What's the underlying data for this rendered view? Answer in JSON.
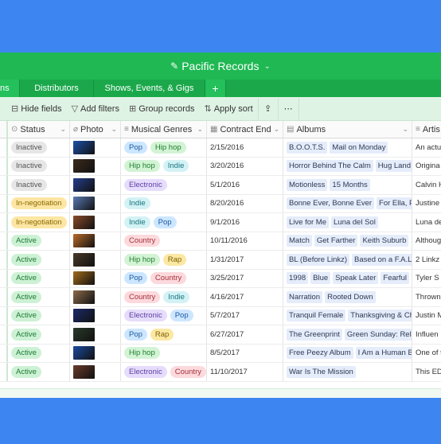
{
  "app": {
    "title": "Pacific Records"
  },
  "tabs": [
    {
      "label": "ns"
    },
    {
      "label": "Distributors"
    },
    {
      "label": "Shows, Events, & Gigs"
    },
    {
      "label": "+"
    }
  ],
  "toolbar": {
    "hide_fields": "Hide fields",
    "add_filters": "Add filters",
    "group_records": "Group records",
    "apply_sort": "Apply sort"
  },
  "columns": [
    "Status",
    "Photo",
    "Musical Genres",
    "Contract End",
    "Albums",
    "Artis"
  ],
  "rows": [
    {
      "status": "Inactive",
      "status_kind": "inactive",
      "photo_color": "#1c4fa8",
      "genres": [
        [
          "Pop",
          "pop"
        ],
        [
          "Hip hop",
          "hiphop"
        ]
      ],
      "date": "2/15/2016",
      "albums": [
        "B.O.O.T.S.",
        "Mail on Monday"
      ],
      "artist": "An actu"
    },
    {
      "status": "Inactive",
      "status_kind": "inactive",
      "photo_color": "#3b2a1c",
      "genres": [
        [
          "Hip hop",
          "hiphop"
        ],
        [
          "Indie",
          "indie"
        ]
      ],
      "date": "3/20/2016",
      "albums": [
        "Horror Behind The Calm",
        "Hug Land"
      ],
      "artist": "Origina"
    },
    {
      "status": "Inactive",
      "status_kind": "inactive",
      "photo_color": "#243e8c",
      "genres": [
        [
          "Electronic",
          "electronic"
        ]
      ],
      "date": "5/1/2016",
      "albums": [
        "Motionless",
        "15 Months"
      ],
      "artist": "Calvin H"
    },
    {
      "status": "In-negotiation",
      "status_kind": "neg",
      "photo_color": "#5a7ab4",
      "genres": [
        [
          "Indie",
          "indie"
        ]
      ],
      "date": "8/20/2016",
      "albums": [
        "Bonne Ever, Bonne Ever",
        "For Ella, P"
      ],
      "artist": "Justine"
    },
    {
      "status": "In-negotiation",
      "status_kind": "neg",
      "photo_color": "#8a4a2a",
      "genres": [
        [
          "Indie",
          "indie"
        ],
        [
          "Pop",
          "pop"
        ]
      ],
      "date": "9/1/2016",
      "albums": [
        "Live for Me",
        "Luna del Sol"
      ],
      "artist": "Luna de"
    },
    {
      "status": "Active",
      "status_kind": "active",
      "photo_color": "#b96a2a",
      "genres": [
        [
          "Country",
          "country"
        ]
      ],
      "date": "10/11/2016",
      "albums": [
        "Match",
        "Get Farther",
        "Keith Suburb"
      ],
      "artist": "Althoug"
    },
    {
      "status": "Active",
      "status_kind": "active",
      "photo_color": "#4a3a2a",
      "genres": [
        [
          "Hip hop",
          "hiphop"
        ],
        [
          "Rap",
          "rap"
        ]
      ],
      "date": "1/31/2017",
      "albums": [
        "BL (Before Linkz)",
        "Based on a F.A.L"
      ],
      "artist": "2 Linkz"
    },
    {
      "status": "Active",
      "status_kind": "active",
      "photo_color": "#a26a1c",
      "genres": [
        [
          "Pop",
          "pop"
        ],
        [
          "Country",
          "country"
        ]
      ],
      "date": "3/25/2017",
      "albums": [
        "1998",
        "Blue",
        "Speak Later",
        "Fearful"
      ],
      "artist": "Tyler S"
    },
    {
      "status": "Active",
      "status_kind": "active",
      "photo_color": "#8c6a4a",
      "genres": [
        [
          "Country",
          "country"
        ],
        [
          "Indie",
          "indie"
        ]
      ],
      "date": "4/16/2017",
      "albums": [
        "Narration",
        "Rooted Down"
      ],
      "artist": "Thrown"
    },
    {
      "status": "Active",
      "status_kind": "active",
      "photo_color": "#1a2a6a",
      "genres": [
        [
          "Electronic",
          "electronic"
        ],
        [
          "Pop",
          "pop"
        ]
      ],
      "date": "5/7/2017",
      "albums": [
        "Tranquil Female",
        "Thanksgiving & Ch"
      ],
      "artist": "Justin M"
    },
    {
      "status": "Active",
      "status_kind": "active",
      "photo_color": "#2a3a2a",
      "genres": [
        [
          "Pop",
          "pop"
        ],
        [
          "Rap",
          "rap"
        ]
      ],
      "date": "6/27/2017",
      "albums": [
        "The Greenprint",
        "Green Sunday: Rel"
      ],
      "artist": "Influen"
    },
    {
      "status": "Active",
      "status_kind": "active",
      "photo_color": "#1a4aa0",
      "genres": [
        [
          "Hip hop",
          "hiphop"
        ]
      ],
      "date": "8/5/2017",
      "albums": [
        "Free Peezy Album",
        "I Am a Human B"
      ],
      "artist": "One of t"
    },
    {
      "status": "Active",
      "status_kind": "active",
      "photo_color": "#6a3a2a",
      "genres": [
        [
          "Electronic",
          "electronic"
        ],
        [
          "Country",
          "country"
        ]
      ],
      "date": "11/10/2017",
      "albums": [
        "War Is The Mission"
      ],
      "artist": "This ED"
    }
  ]
}
